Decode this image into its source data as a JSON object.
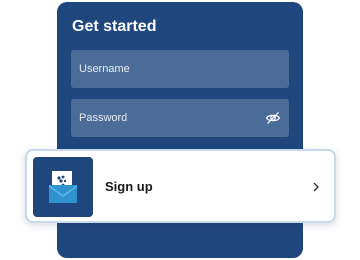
{
  "card": {
    "title": "Get started"
  },
  "fields": {
    "username_placeholder": "Username",
    "password_placeholder": "Password",
    "password_toggle_icon": "eye-off-icon"
  },
  "signup": {
    "label": "Sign up",
    "tile_icon": "mail-envelope-icon",
    "arrow_icon": "chevron-right-icon"
  },
  "colors": {
    "card_background": "#1f467d",
    "field_background": "#4c6c98",
    "signup_border": "#c7d9ea"
  }
}
